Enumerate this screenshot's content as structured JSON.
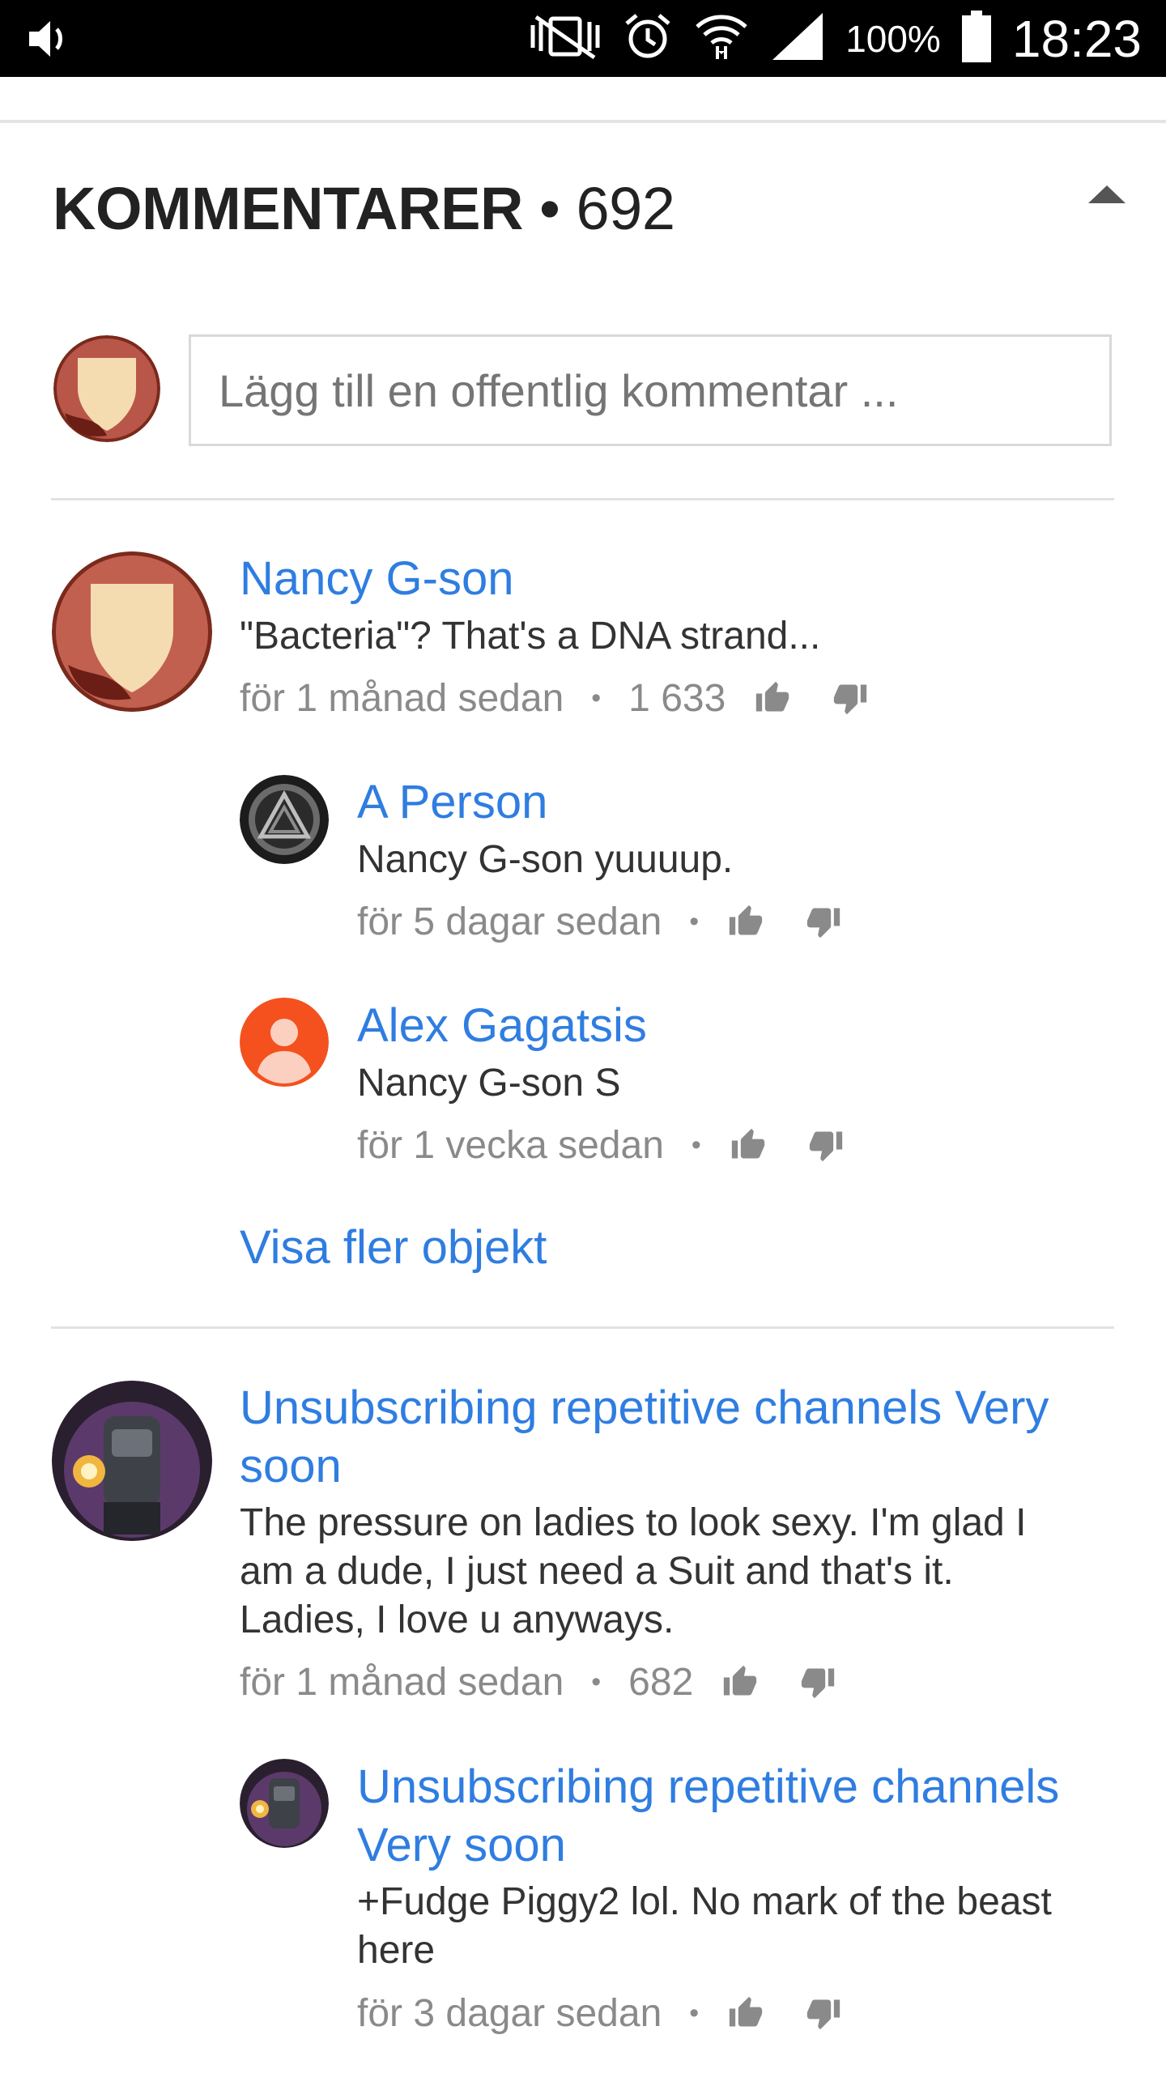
{
  "status_bar": {
    "icons": [
      "volume-icon",
      "vibrate-off-icon",
      "alarm-icon",
      "wifi-icon",
      "signal-icon",
      "battery-icon"
    ],
    "battery": "100%",
    "time": "18:23"
  },
  "header": {
    "title": "KOMMENTARER",
    "separator": "•",
    "count": "692"
  },
  "composer": {
    "placeholder": "Lägg till en offentlig kommentar ..."
  },
  "comments": [
    {
      "author": "Nancy G-son",
      "text": "\"Bacteria\"? That's a DNA strand...",
      "time": "för 1 månad sedan",
      "likes": "1 633",
      "replies": [
        {
          "author": "A Person",
          "text": "Nancy G-son yuuuup.",
          "time": "för 5 dagar sedan"
        },
        {
          "author": "Alex Gagatsis",
          "text": "Nancy G-son S",
          "time": "för 1 vecka sedan"
        }
      ],
      "more_label": "Visa fler objekt"
    },
    {
      "author_line1": "Unsubscribing repetitive channels Very",
      "author_line2": "soon",
      "text_lines": [
        "The pressure on ladies to look sexy. I'm glad I",
        "am a dude, I just need a Suit and that's it.",
        "Ladies, I love u anyways."
      ],
      "time": "för 1 månad sedan",
      "likes": "682",
      "replies": [
        {
          "author_line1": "Unsubscribing repetitive channels",
          "author_line2": "Very soon",
          "text_lines": [
            "+Fudge Piggy2 lol. No mark of the beast",
            "here"
          ],
          "time": "för 3 dagar sedan"
        }
      ]
    }
  ],
  "meta_separator": "•",
  "colors": {
    "link": "#2f7de1",
    "meta": "#8a8a8a",
    "status_bar": "#000000"
  }
}
